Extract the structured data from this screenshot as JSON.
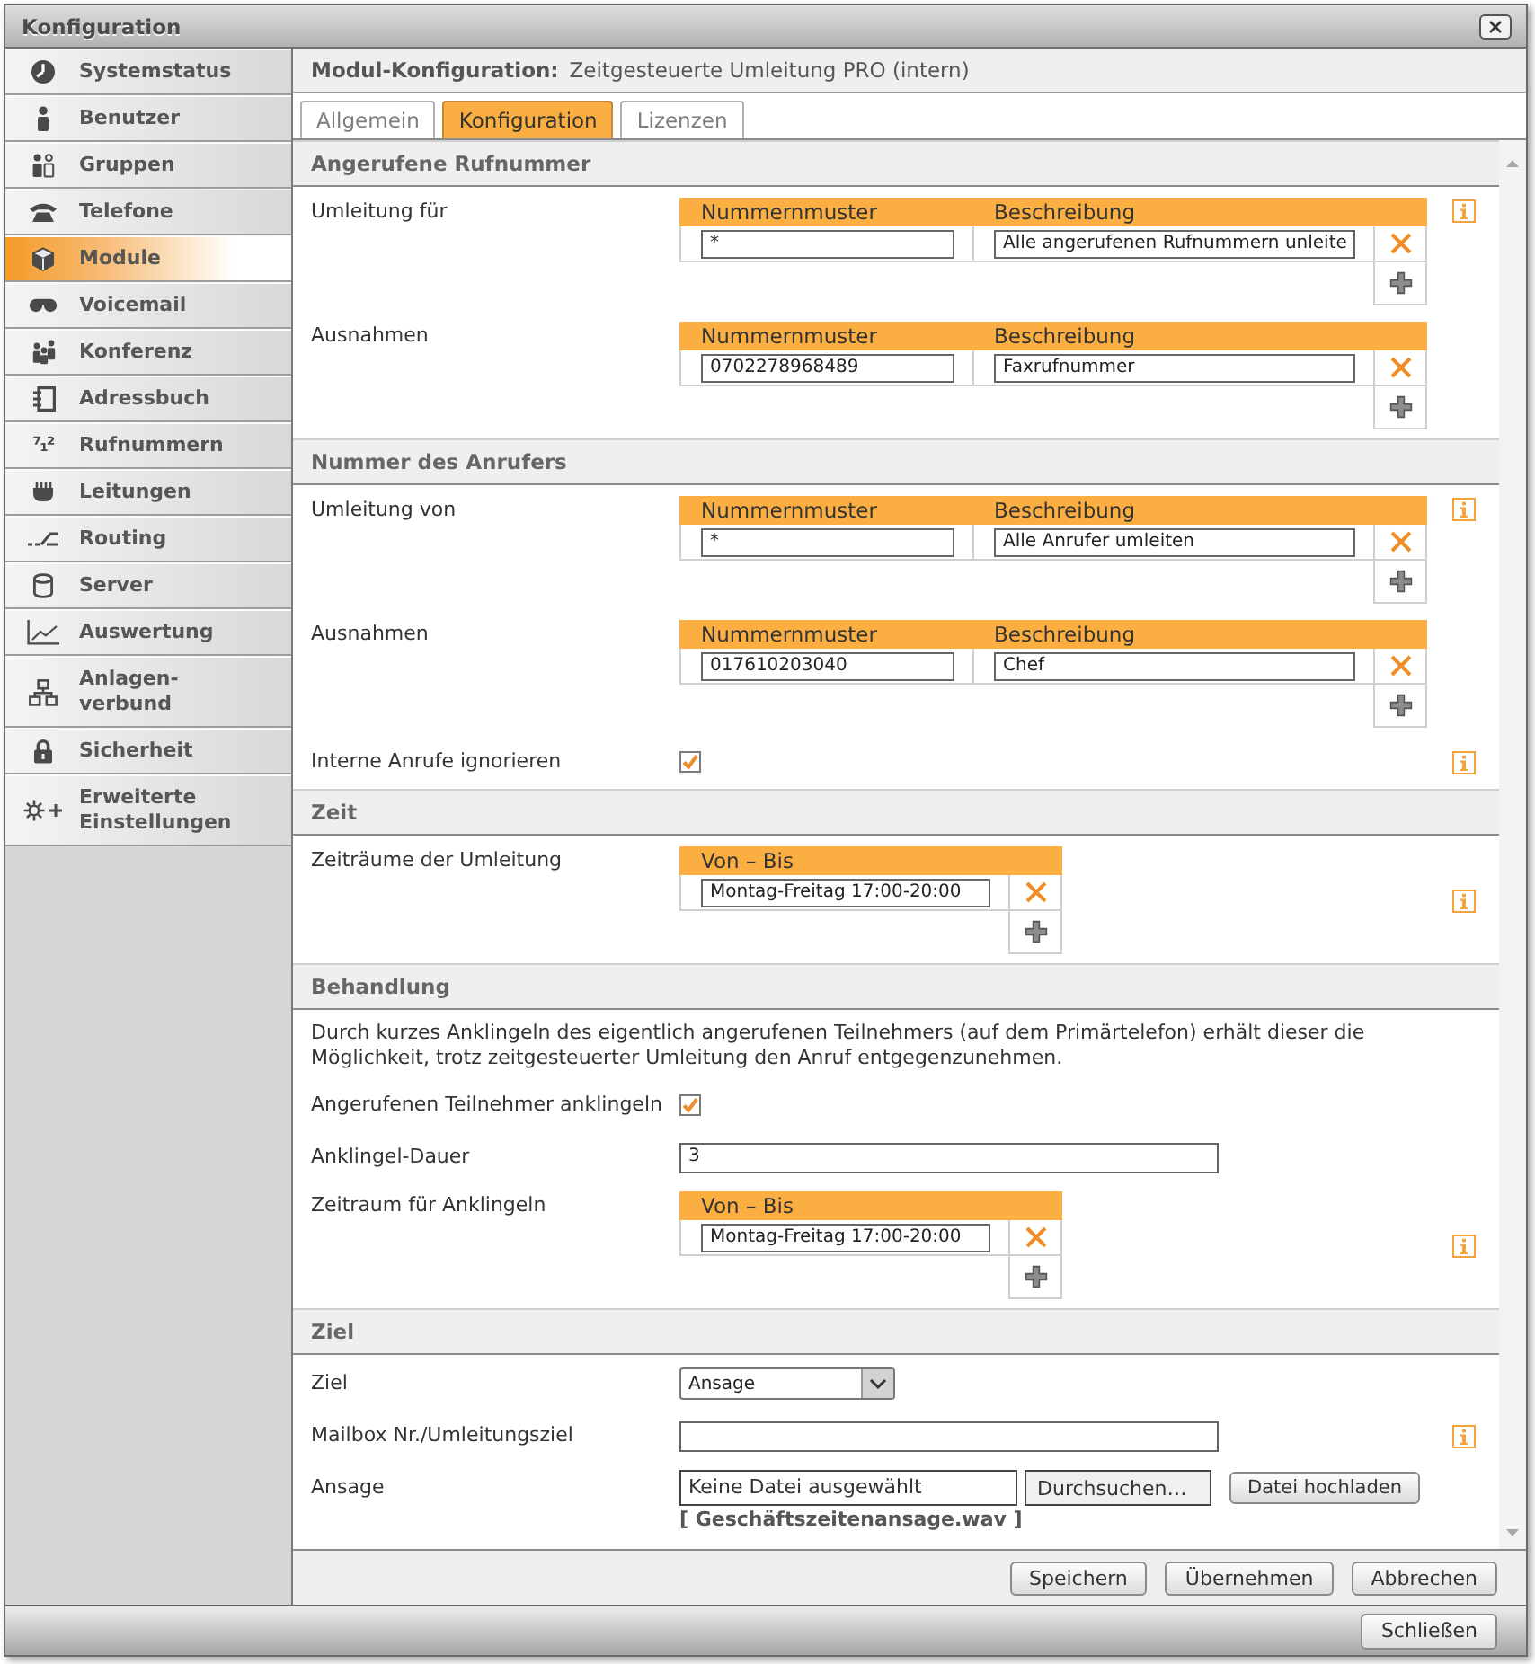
{
  "window": {
    "title": "Konfiguration"
  },
  "sidebar": {
    "items": [
      {
        "label": "Systemstatus",
        "selected": false
      },
      {
        "label": "Benutzer",
        "selected": false
      },
      {
        "label": "Gruppen",
        "selected": false
      },
      {
        "label": "Telefone",
        "selected": false
      },
      {
        "label": "Module",
        "selected": true
      },
      {
        "label": "Voicemail",
        "selected": false
      },
      {
        "label": "Konferenz",
        "selected": false
      },
      {
        "label": "Adressbuch",
        "selected": false
      },
      {
        "label": "Rufnummern",
        "selected": false,
        "glyph": "⁷₁²"
      },
      {
        "label": "Leitungen",
        "selected": false
      },
      {
        "label": "Routing",
        "selected": false
      },
      {
        "label": "Server",
        "selected": false
      },
      {
        "label": "Auswertung",
        "selected": false
      },
      {
        "label": "Anlagen-verbund",
        "selected": false
      },
      {
        "label": "Sicherheit",
        "selected": false
      },
      {
        "label": "Erweiterte Einstellungen",
        "selected": false
      }
    ]
  },
  "module_header": {
    "label": "Modul-Konfiguration:",
    "value": "Zeitgesteuerte Umleitung PRO (intern)"
  },
  "tabs": [
    {
      "label": "Allgemein",
      "selected": false
    },
    {
      "label": "Konfiguration",
      "selected": true
    },
    {
      "label": "Lizenzen",
      "selected": false
    }
  ],
  "sections": [
    {
      "title": "Angerufene Rufnummer",
      "rows": [
        {
          "kind": "pattern_table",
          "label": "Umleitung für",
          "info": true,
          "columns": [
            "Nummernmuster",
            "Beschreibung"
          ],
          "rows": [
            [
              "*",
              "Alle angerufenen Rufnummern unleite"
            ]
          ]
        },
        {
          "kind": "pattern_table",
          "label": "Ausnahmen",
          "info": false,
          "columns": [
            "Nummernmuster",
            "Beschreibung"
          ],
          "rows": [
            [
              "0702278968489",
              "Faxrufnummer"
            ]
          ]
        }
      ]
    },
    {
      "title": "Nummer des Anrufers",
      "rows": [
        {
          "kind": "pattern_table",
          "label": "Umleitung von",
          "info": true,
          "columns": [
            "Nummernmuster",
            "Beschreibung"
          ],
          "rows": [
            [
              "*",
              "Alle Anrufer umleiten"
            ]
          ]
        },
        {
          "kind": "pattern_table",
          "label": "Ausnahmen",
          "info": false,
          "columns": [
            "Nummernmuster",
            "Beschreibung"
          ],
          "rows": [
            [
              "017610203040",
              "Chef"
            ]
          ]
        },
        {
          "kind": "checkbox",
          "label": "Interne Anrufe ignorieren",
          "checked": true,
          "info": true
        }
      ]
    },
    {
      "title": "Zeit",
      "rows": [
        {
          "kind": "time_table",
          "label": "Zeiträume der Umleitung",
          "info": true,
          "columns": [
            "Von – Bis"
          ],
          "rows": [
            [
              "Montag-Freitag 17:00-20:00"
            ]
          ]
        }
      ]
    },
    {
      "title": "Behandlung",
      "rows": [
        {
          "kind": "paragraph",
          "text": "Durch kurzes Anklingeln des eigentlich angerufenen Teilnehmers (auf dem Primärtelefon) erhält dieser die Möglichkeit, trotz zeitgesteuerter Umleitung den Anruf entgegenzunehmen."
        },
        {
          "kind": "checkbox",
          "label": "Angerufenen Teilnehmer anklingeln",
          "checked": true,
          "info": false
        },
        {
          "kind": "text",
          "label": "Anklingel-Dauer",
          "value": "3",
          "info": false
        },
        {
          "kind": "time_table",
          "label": "Zeitraum für Anklingeln",
          "info": true,
          "columns": [
            "Von – Bis"
          ],
          "rows": [
            [
              "Montag-Freitag 17:00-20:00"
            ]
          ]
        }
      ]
    },
    {
      "title": "Ziel",
      "rows": [
        {
          "kind": "select",
          "label": "Ziel",
          "value": "Ansage",
          "info": false
        },
        {
          "kind": "text",
          "label": "Mailbox Nr./Umleitungsziel",
          "info": true
        },
        {
          "kind": "file",
          "label": "Ansage",
          "value": "Keine Datei ausgewählt",
          "browse": "Durchsuchen…",
          "upload": "Datei hochladen",
          "current_file": "[ Geschäftszeitenansage.wav ]",
          "info": false
        }
      ]
    }
  ],
  "footer": {
    "buttons": [
      "Speichern",
      "Übernehmen",
      "Abbrechen"
    ]
  },
  "bottom_bar": {
    "buttons": [
      "Schließen"
    ]
  }
}
